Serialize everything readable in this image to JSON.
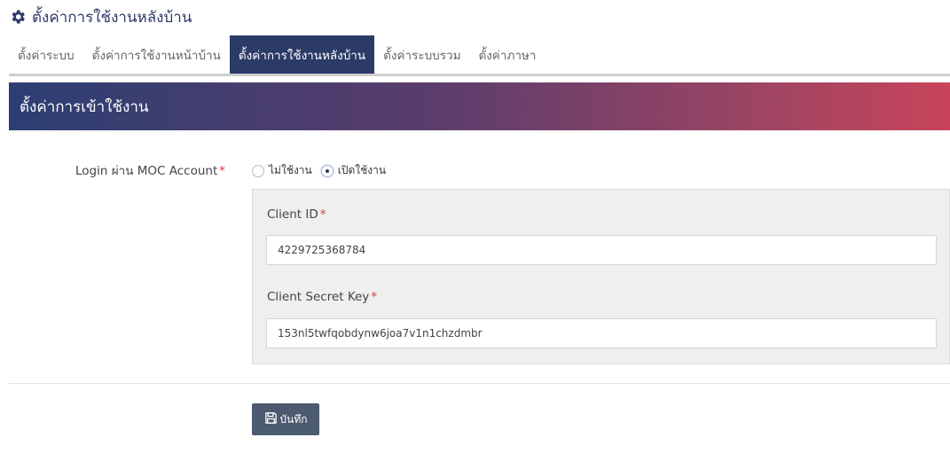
{
  "page": {
    "title": "ตั้งค่าการใช้งานหลังบ้าน",
    "icon": "gear-icon"
  },
  "tabs": [
    {
      "label": "ตั้งค่าระบบ",
      "active": false
    },
    {
      "label": "ตั้งค่าการใช้งานหน้าบ้าน",
      "active": false
    },
    {
      "label": "ตั้งค่าการใช้งานหลังบ้าน",
      "active": true
    },
    {
      "label": "ตั้งค่าระบบรวม",
      "active": false
    },
    {
      "label": "ตั้งค่าภาษา",
      "active": false
    }
  ],
  "section": {
    "title": "ตั้งค่าการเข้าใช้งาน"
  },
  "login": {
    "label": "Login ผ่าน MOC Account",
    "required_mark": "*",
    "options": [
      {
        "label": "ไม่ใช้งาน",
        "selected": false
      },
      {
        "label": "เปิดใช้งาน",
        "selected": true
      }
    ]
  },
  "client_id": {
    "label": "Client ID",
    "required_mark": "*",
    "value": "4229725368784"
  },
  "client_secret": {
    "label": "Client Secret Key",
    "required_mark": "*",
    "value": "153nl5twfqobdynw6joa7v1n1chzdmbr"
  },
  "actions": {
    "save_label": "บันทึก",
    "save_icon": "floppy-disk-icon"
  },
  "colors": {
    "primary": "#2b3a67",
    "required": "#d9363e",
    "header_gradient_start": "#2c3e72",
    "header_gradient_end": "#c8445a",
    "button": "#4b5a6e"
  }
}
